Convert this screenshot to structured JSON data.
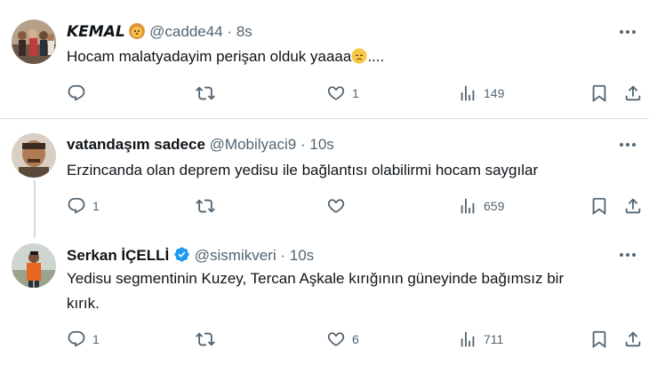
{
  "tweets": [
    {
      "display_name": "𝙆𝙀𝙈𝘼𝙇",
      "handle": "@cadde44",
      "separator": "·",
      "time": "8s",
      "text": "Hocam malatyadayim perişan olduk yaaaa",
      "text_suffix": "....",
      "name_emoji_icon": "lion-face-icon",
      "text_emoji_icon": "pensive-face-icon",
      "stats": {
        "replies": "",
        "retweets": "",
        "likes": "1",
        "views": "149"
      }
    },
    {
      "display_name": "vatandaşım sadece",
      "handle": "@Mobilyaci9",
      "separator": "·",
      "time": "10s",
      "text": "Erzincanda olan deprem yedisu ile bağlantısı olabilirmi hocam saygılar",
      "stats": {
        "replies": "1",
        "retweets": "",
        "likes": "",
        "views": "659"
      }
    },
    {
      "display_name": "Serkan İÇELLİ",
      "handle": "@sismikveri",
      "separator": "·",
      "time": "10s",
      "text_line1": "Yedisu segmentinin Kuzey, Tercan Aşkale kırığının güneyinde bağımsız bir",
      "text_line2": "kırık.",
      "verified_icon": "verified-badge-icon",
      "stats": {
        "replies": "1",
        "retweets": "",
        "likes": "6",
        "views": "711"
      }
    }
  ],
  "colors": {
    "text": "#0f1419",
    "secondary": "#536471",
    "divider": "#d6dbdf",
    "verified": "#1d9bf0"
  }
}
